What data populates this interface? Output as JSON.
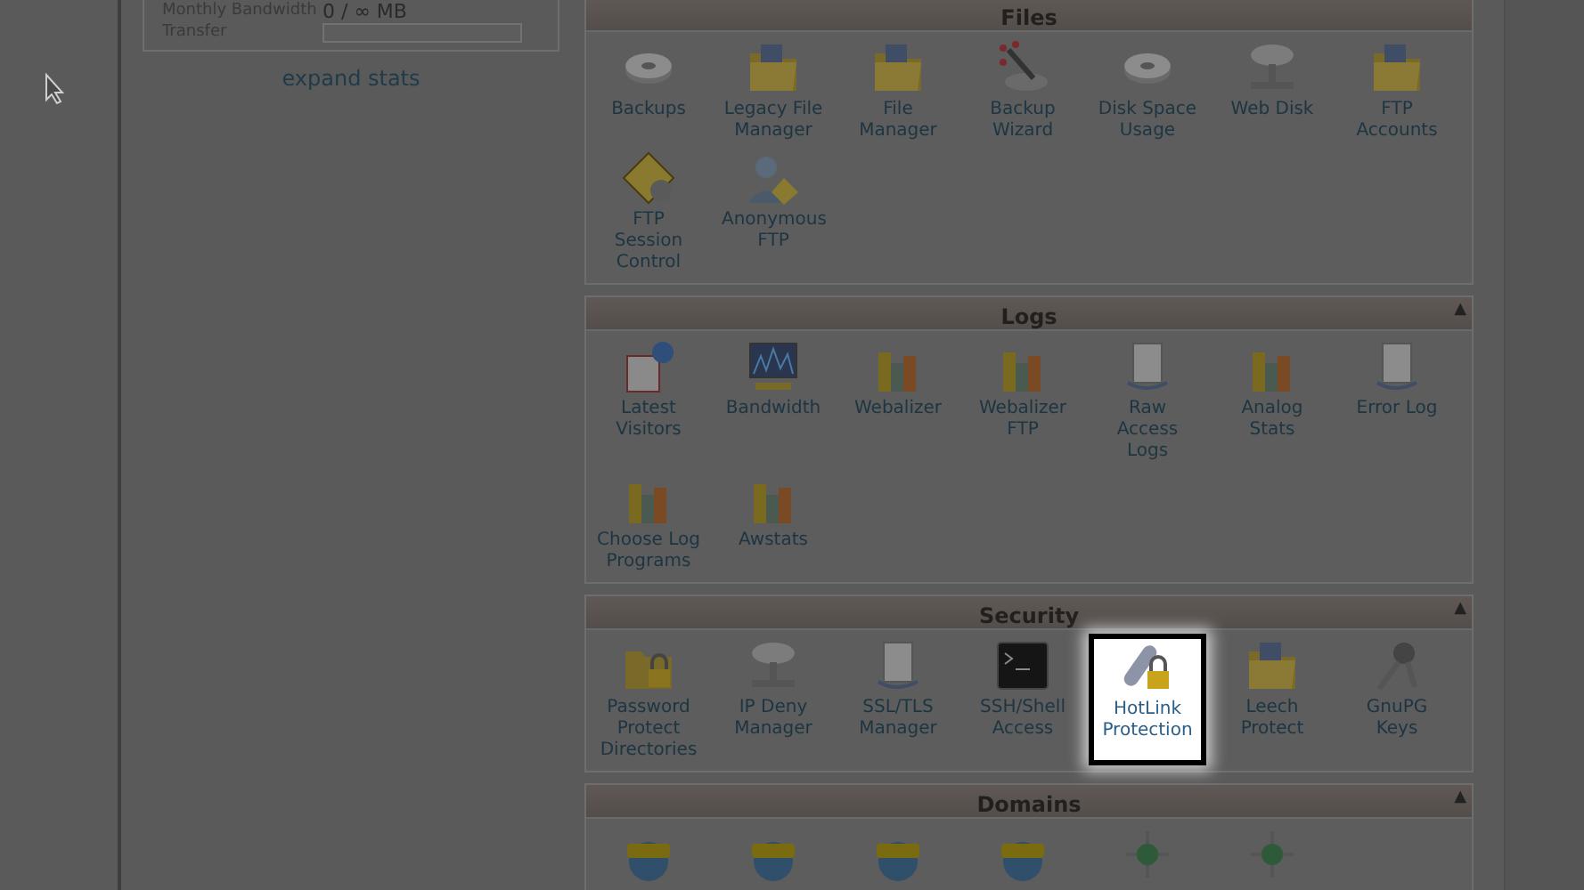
{
  "sidebar": {
    "stats": [
      {
        "label": "Monthly Bandwidth",
        "value": "0 / ∞ MB"
      },
      {
        "label": "Transfer",
        "kind": "bar"
      }
    ],
    "expand_link": "expand stats"
  },
  "sections": [
    {
      "title": "Files",
      "items": [
        {
          "label": "Backups",
          "selected": false
        },
        {
          "label": "Legacy File Manager",
          "selected": false
        },
        {
          "label": "File Manager",
          "selected": false
        },
        {
          "label": "Backup Wizard",
          "selected": false
        },
        {
          "label": "Disk Space Usage",
          "selected": false
        },
        {
          "label": "Web Disk",
          "selected": false
        },
        {
          "label": "FTP Accounts",
          "selected": false
        },
        {
          "label": "FTP Session Control",
          "selected": false
        },
        {
          "label": "Anonymous FTP",
          "selected": false
        }
      ]
    },
    {
      "title": "Logs",
      "toggle": "▲",
      "items": [
        {
          "label": "Latest Visitors",
          "selected": false
        },
        {
          "label": "Bandwidth",
          "selected": false
        },
        {
          "label": "Webalizer",
          "selected": false
        },
        {
          "label": "Webalizer FTP",
          "selected": false
        },
        {
          "label": "Raw Access Logs",
          "selected": false
        },
        {
          "label": "Analog Stats",
          "selected": false
        },
        {
          "label": "Error Log",
          "selected": false
        },
        {
          "label": "Choose Log Programs",
          "selected": false
        },
        {
          "label": "Awstats",
          "selected": false
        }
      ]
    },
    {
      "title": "Security",
      "toggle": "▲",
      "items": [
        {
          "label": "Password Protect Directories",
          "selected": false
        },
        {
          "label": "IP Deny Manager",
          "selected": false
        },
        {
          "label": "SSL/TLS Manager",
          "selected": false
        },
        {
          "label": "SSH/Shell Access",
          "selected": false
        },
        {
          "label": "HotLink Protection",
          "selected": true
        },
        {
          "label": "Leech Protect",
          "selected": false
        },
        {
          "label": "GnuPG Keys",
          "selected": false
        }
      ]
    },
    {
      "title": "Domains",
      "toggle": "▲",
      "items": [
        {
          "kind": "icon"
        },
        {
          "kind": "icon"
        },
        {
          "kind": "icon"
        },
        {
          "kind": "icon"
        },
        {
          "kind": "icon"
        },
        {
          "kind": "icon"
        }
      ]
    }
  ]
}
